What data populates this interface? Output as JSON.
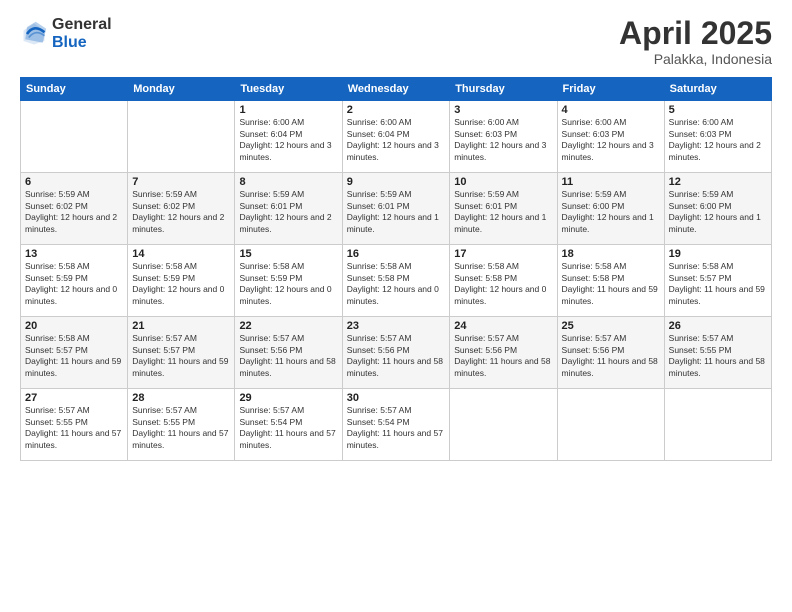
{
  "logo": {
    "general": "General",
    "blue": "Blue"
  },
  "header": {
    "month": "April 2025",
    "location": "Palakka, Indonesia"
  },
  "weekdays": [
    "Sunday",
    "Monday",
    "Tuesday",
    "Wednesday",
    "Thursday",
    "Friday",
    "Saturday"
  ],
  "weeks": [
    [
      {
        "day": "",
        "sunrise": "",
        "sunset": "",
        "daylight": ""
      },
      {
        "day": "",
        "sunrise": "",
        "sunset": "",
        "daylight": ""
      },
      {
        "day": "1",
        "sunrise": "Sunrise: 6:00 AM",
        "sunset": "Sunset: 6:04 PM",
        "daylight": "Daylight: 12 hours and 3 minutes."
      },
      {
        "day": "2",
        "sunrise": "Sunrise: 6:00 AM",
        "sunset": "Sunset: 6:04 PM",
        "daylight": "Daylight: 12 hours and 3 minutes."
      },
      {
        "day": "3",
        "sunrise": "Sunrise: 6:00 AM",
        "sunset": "Sunset: 6:03 PM",
        "daylight": "Daylight: 12 hours and 3 minutes."
      },
      {
        "day": "4",
        "sunrise": "Sunrise: 6:00 AM",
        "sunset": "Sunset: 6:03 PM",
        "daylight": "Daylight: 12 hours and 3 minutes."
      },
      {
        "day": "5",
        "sunrise": "Sunrise: 6:00 AM",
        "sunset": "Sunset: 6:03 PM",
        "daylight": "Daylight: 12 hours and 2 minutes."
      }
    ],
    [
      {
        "day": "6",
        "sunrise": "Sunrise: 5:59 AM",
        "sunset": "Sunset: 6:02 PM",
        "daylight": "Daylight: 12 hours and 2 minutes."
      },
      {
        "day": "7",
        "sunrise": "Sunrise: 5:59 AM",
        "sunset": "Sunset: 6:02 PM",
        "daylight": "Daylight: 12 hours and 2 minutes."
      },
      {
        "day": "8",
        "sunrise": "Sunrise: 5:59 AM",
        "sunset": "Sunset: 6:01 PM",
        "daylight": "Daylight: 12 hours and 2 minutes."
      },
      {
        "day": "9",
        "sunrise": "Sunrise: 5:59 AM",
        "sunset": "Sunset: 6:01 PM",
        "daylight": "Daylight: 12 hours and 1 minute."
      },
      {
        "day": "10",
        "sunrise": "Sunrise: 5:59 AM",
        "sunset": "Sunset: 6:01 PM",
        "daylight": "Daylight: 12 hours and 1 minute."
      },
      {
        "day": "11",
        "sunrise": "Sunrise: 5:59 AM",
        "sunset": "Sunset: 6:00 PM",
        "daylight": "Daylight: 12 hours and 1 minute."
      },
      {
        "day": "12",
        "sunrise": "Sunrise: 5:59 AM",
        "sunset": "Sunset: 6:00 PM",
        "daylight": "Daylight: 12 hours and 1 minute."
      }
    ],
    [
      {
        "day": "13",
        "sunrise": "Sunrise: 5:58 AM",
        "sunset": "Sunset: 5:59 PM",
        "daylight": "Daylight: 12 hours and 0 minutes."
      },
      {
        "day": "14",
        "sunrise": "Sunrise: 5:58 AM",
        "sunset": "Sunset: 5:59 PM",
        "daylight": "Daylight: 12 hours and 0 minutes."
      },
      {
        "day": "15",
        "sunrise": "Sunrise: 5:58 AM",
        "sunset": "Sunset: 5:59 PM",
        "daylight": "Daylight: 12 hours and 0 minutes."
      },
      {
        "day": "16",
        "sunrise": "Sunrise: 5:58 AM",
        "sunset": "Sunset: 5:58 PM",
        "daylight": "Daylight: 12 hours and 0 minutes."
      },
      {
        "day": "17",
        "sunrise": "Sunrise: 5:58 AM",
        "sunset": "Sunset: 5:58 PM",
        "daylight": "Daylight: 12 hours and 0 minutes."
      },
      {
        "day": "18",
        "sunrise": "Sunrise: 5:58 AM",
        "sunset": "Sunset: 5:58 PM",
        "daylight": "Daylight: 11 hours and 59 minutes."
      },
      {
        "day": "19",
        "sunrise": "Sunrise: 5:58 AM",
        "sunset": "Sunset: 5:57 PM",
        "daylight": "Daylight: 11 hours and 59 minutes."
      }
    ],
    [
      {
        "day": "20",
        "sunrise": "Sunrise: 5:58 AM",
        "sunset": "Sunset: 5:57 PM",
        "daylight": "Daylight: 11 hours and 59 minutes."
      },
      {
        "day": "21",
        "sunrise": "Sunrise: 5:57 AM",
        "sunset": "Sunset: 5:57 PM",
        "daylight": "Daylight: 11 hours and 59 minutes."
      },
      {
        "day": "22",
        "sunrise": "Sunrise: 5:57 AM",
        "sunset": "Sunset: 5:56 PM",
        "daylight": "Daylight: 11 hours and 58 minutes."
      },
      {
        "day": "23",
        "sunrise": "Sunrise: 5:57 AM",
        "sunset": "Sunset: 5:56 PM",
        "daylight": "Daylight: 11 hours and 58 minutes."
      },
      {
        "day": "24",
        "sunrise": "Sunrise: 5:57 AM",
        "sunset": "Sunset: 5:56 PM",
        "daylight": "Daylight: 11 hours and 58 minutes."
      },
      {
        "day": "25",
        "sunrise": "Sunrise: 5:57 AM",
        "sunset": "Sunset: 5:56 PM",
        "daylight": "Daylight: 11 hours and 58 minutes."
      },
      {
        "day": "26",
        "sunrise": "Sunrise: 5:57 AM",
        "sunset": "Sunset: 5:55 PM",
        "daylight": "Daylight: 11 hours and 58 minutes."
      }
    ],
    [
      {
        "day": "27",
        "sunrise": "Sunrise: 5:57 AM",
        "sunset": "Sunset: 5:55 PM",
        "daylight": "Daylight: 11 hours and 57 minutes."
      },
      {
        "day": "28",
        "sunrise": "Sunrise: 5:57 AM",
        "sunset": "Sunset: 5:55 PM",
        "daylight": "Daylight: 11 hours and 57 minutes."
      },
      {
        "day": "29",
        "sunrise": "Sunrise: 5:57 AM",
        "sunset": "Sunset: 5:54 PM",
        "daylight": "Daylight: 11 hours and 57 minutes."
      },
      {
        "day": "30",
        "sunrise": "Sunrise: 5:57 AM",
        "sunset": "Sunset: 5:54 PM",
        "daylight": "Daylight: 11 hours and 57 minutes."
      },
      {
        "day": "",
        "sunrise": "",
        "sunset": "",
        "daylight": ""
      },
      {
        "day": "",
        "sunrise": "",
        "sunset": "",
        "daylight": ""
      },
      {
        "day": "",
        "sunrise": "",
        "sunset": "",
        "daylight": ""
      }
    ]
  ]
}
